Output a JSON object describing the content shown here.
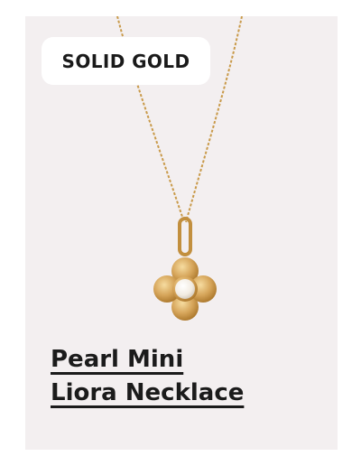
{
  "badge": {
    "label": "SOLID GOLD"
  },
  "product": {
    "title_line1": "Pearl Mini",
    "title_line2": "Liora Necklace"
  },
  "colors": {
    "background": "#f3eff0",
    "gold": "#c99a4a",
    "pearl": "#f6f2ea"
  },
  "image": {
    "icon": "pearl-flower-pendant-necklace"
  }
}
